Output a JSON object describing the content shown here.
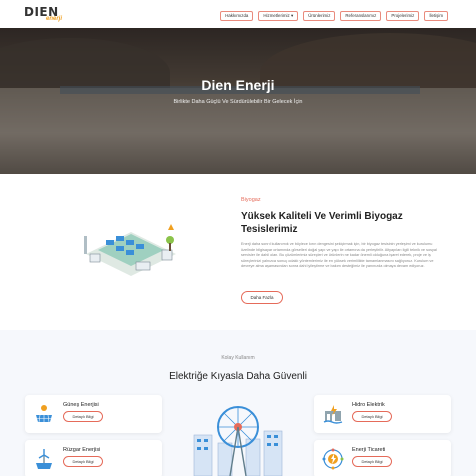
{
  "header": {
    "logo_text": "DIEN",
    "logo_sub": "enerji",
    "nav": [
      "Hakkımızda",
      "Hizmetlerimiz",
      "Ürünlerimiz",
      "Referanslarımız",
      "Projelerimiz",
      "İletişim"
    ]
  },
  "hero": {
    "title": "Dien Enerji",
    "subtitle": "Birlikte Daha Güçlü Ve Sürdürülebilir Bir Gelecek İçin"
  },
  "biyogaz": {
    "tag": "Biyogaz",
    "title": "Yüksek Kaliteli Ve Verimli Biyogaz Tesislerimiz",
    "text": "Enerji daha sonrıl kullanımık ve böylece kırın dengesini şekiçirmak için, bir biyogaz tesisinin yerleşimi ve kurulumu özelinde bilgisayar ortamında görselleri doğal yapı ve yapı ile ortamına da yerleştirilir. Altyapıları ilgili teknik ve sosyal servisler ile dahil olan. Bu çözümlerimiz süreçleri ve ürünlerin ne kadar önemli olduğuna işaret ederek, proje ve iş süreçlerinizi yalnızca sonuç odaklı yöntemlerimiz ile en yüksek verimlilikte tamamlanmasını sağlıyoruz. Kurulum ve devreye alma aşamasından sonra dahi iyileştirme ve bakım desteğimiz ile yanınızda olmaya devam ediyoruz.",
    "button": "Daha Fazla"
  },
  "services": {
    "tag": "Kolay Kullanım",
    "title": "Elektriğe Kıyasla Daha Güvenli",
    "cards": [
      {
        "title": "Güneş Enerjisi",
        "button": "Detaylı Bilgi"
      },
      {
        "title": "Hidro Elektrik",
        "button": "Detaylı Bilgi"
      },
      {
        "title": "Rüzgar Enerjisi",
        "button": "Detaylı Bilgi"
      },
      {
        "title": "Enerji Ticareti",
        "button": "Detaylı Bilgi"
      }
    ]
  },
  "colors": {
    "accent": "#e56b5a",
    "brand_orange": "#f0a020"
  }
}
